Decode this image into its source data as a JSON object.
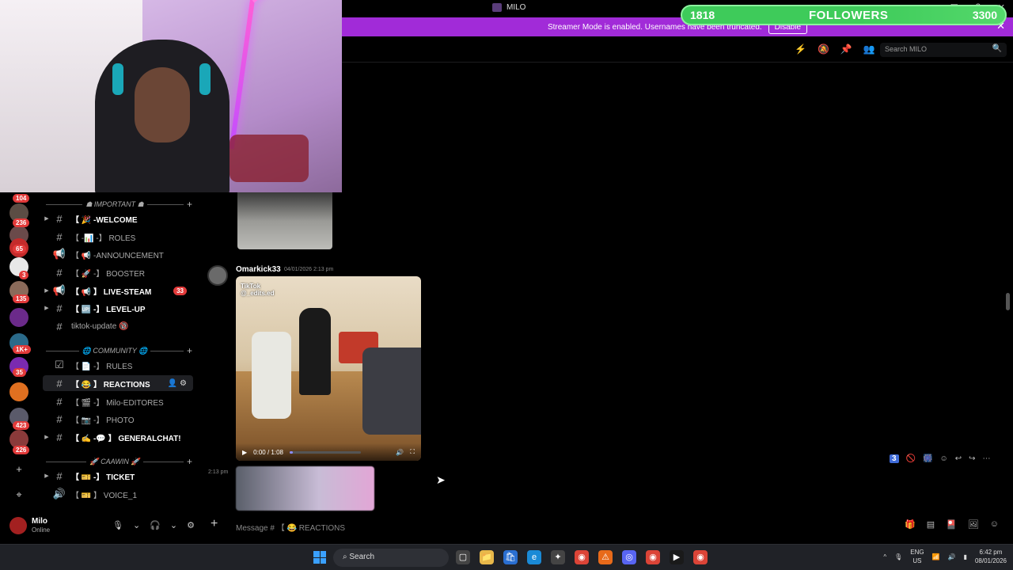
{
  "titlebar": {
    "app_name": "MILO",
    "controls": [
      "—",
      "☐",
      "?",
      "✕"
    ]
  },
  "streamer": {
    "message": "Streamer Mode is enabled. Usernames have been truncated.",
    "disable_label": "Disable",
    "close": "✕"
  },
  "followers": {
    "current": "1818",
    "label": "FOLLOWERS",
    "goal": "3300",
    "progress": 0.55
  },
  "rail": {
    "badges": [
      "104",
      "236",
      "65",
      "3",
      "135",
      "1K+",
      "35",
      "423",
      "226"
    ],
    "add_icon": "+",
    "discover_icon": "⌖"
  },
  "channels": {
    "categories": [
      {
        "label": "☗ IMPORTANT ☗",
        "plus": "+"
      },
      {
        "label": "🌐 COMMUNITY 🌐",
        "plus": "+"
      },
      {
        "label": "🚀 CAAWIN 🚀",
        "plus": "+"
      }
    ],
    "items": [
      {
        "icon": "#",
        "name": "【 🎉 -WELCOME",
        "bold": true,
        "arrow": "▶"
      },
      {
        "icon": "#",
        "name": "【 -📊 -】 ROLES",
        "bold": false,
        "arrow": ""
      },
      {
        "icon": "📢",
        "name": "【 📢 -ANNOUNCEMENT",
        "bold": false,
        "arrow": ""
      },
      {
        "icon": "#",
        "name": "【 🚀 -】 BOOSTER",
        "bold": false,
        "arrow": ""
      },
      {
        "icon": "📢",
        "name": "【 📢 】 LIVE-STEAM",
        "bold": true,
        "arrow": "▶",
        "count": "33"
      },
      {
        "icon": "#",
        "name": "【 🆙 -】 LEVEL-UP",
        "bold": true,
        "arrow": "▶"
      },
      {
        "icon": "#",
        "name": "tiktok-update 🔞",
        "bold": false,
        "arrow": ""
      },
      {
        "icon": "☑",
        "name": "【 📄 -】 RULES",
        "bold": false,
        "arrow": ""
      },
      {
        "icon": "#",
        "name": "【 😂 】 REACTIONS",
        "bold": true,
        "arrow": "",
        "active": true
      },
      {
        "icon": "#",
        "name": "【 🎬 -】 Milo-EDITORES",
        "bold": false,
        "arrow": ""
      },
      {
        "icon": "#",
        "name": "【 📷 -】 PHOTO",
        "bold": false,
        "arrow": ""
      },
      {
        "icon": "#",
        "name": "【 ✍ -💬 】 GENERALCHAT!",
        "bold": true,
        "arrow": "▶"
      },
      {
        "icon": "#",
        "name": "【 🎫 -】 TICKET",
        "bold": true,
        "arrow": "▶"
      },
      {
        "icon": "🔊",
        "name": "【 🎫 】 VOICE_1",
        "bold": false,
        "arrow": ""
      }
    ]
  },
  "user": {
    "name": "Milo",
    "status": "Online",
    "controls": [
      "🎙",
      "⌄",
      "🎧",
      "⌄",
      "⚙"
    ]
  },
  "header": {
    "icons": [
      "⚡",
      "🔕",
      "📌",
      "👥"
    ],
    "search_placeholder": "Search MILO",
    "search_icon": "🔍"
  },
  "chat": {
    "message": {
      "author": "Omarkick33",
      "timestamp": "04/01/2026 2:13 pm"
    },
    "video": {
      "watermark": "TikTok",
      "watermark_user": "@_edits.ed",
      "time": "0:00 / 1:08",
      "progress": 0.04
    },
    "message2": {
      "timestamp": "2:13 pm"
    },
    "hover_actions": [
      "3",
      "🚫",
      "🎆",
      "☺",
      "↩",
      "↪",
      "⋯"
    ]
  },
  "composer": {
    "plus": "+",
    "placeholder": "Message # 【 😂 REACTIONS",
    "icons": [
      "🎁",
      "▤",
      "🎴",
      "🖼",
      "☺"
    ]
  },
  "taskbar": {
    "search_label": "Search",
    "apps": [
      "▢",
      "📁",
      "🛍",
      "e",
      "✦",
      "◉",
      "⚠",
      "◎",
      "◉",
      "▶",
      "◉"
    ],
    "tray": {
      "chevron": "^",
      "mic": "🎙",
      "lang_top": "ENG",
      "lang_bottom": "US",
      "wifi": "📶",
      "volume": "🔊",
      "battery": "▮",
      "time": "6:42 pm",
      "date": "08/01/2026"
    }
  }
}
